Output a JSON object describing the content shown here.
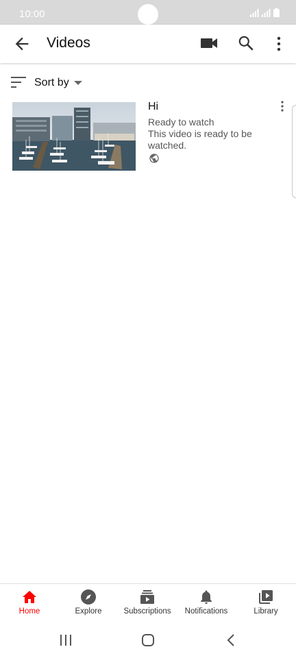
{
  "status": {
    "time": "10:00"
  },
  "header": {
    "title": "Videos"
  },
  "sort": {
    "label": "Sort by"
  },
  "videos": [
    {
      "title": "Hi",
      "status": "Ready to watch",
      "description": "This video is ready to be watched.",
      "visibility_icon": "globe-icon"
    }
  ],
  "bottom_nav": [
    {
      "label": "Home",
      "icon": "home-icon",
      "active": true
    },
    {
      "label": "Explore",
      "icon": "compass-icon"
    },
    {
      "label": "Subscriptions",
      "icon": "subscriptions-icon"
    },
    {
      "label": "Notifications",
      "icon": "bell-icon"
    },
    {
      "label": "Library",
      "icon": "library-icon"
    }
  ],
  "colors": {
    "accent": "#ff0000",
    "icon": "#606060",
    "statusbar": "#d9d9d9"
  }
}
